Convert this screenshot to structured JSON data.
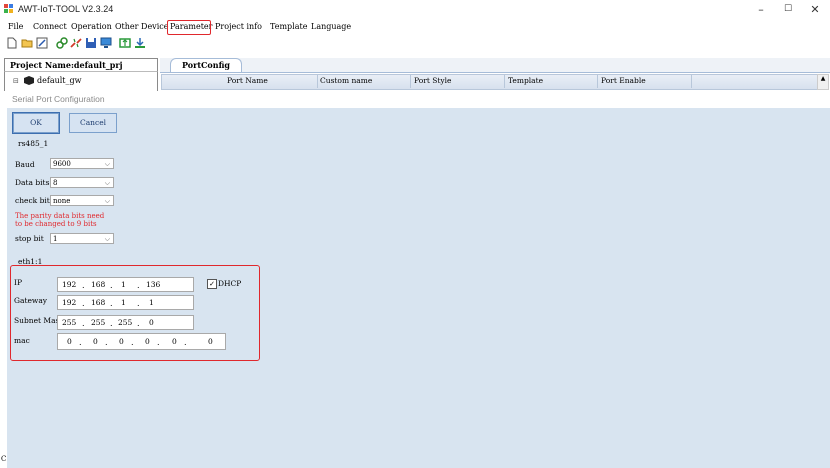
{
  "window": {
    "title": "AWT-IoT-TOOL V2.3.24",
    "controls": {
      "minimize": "–",
      "maximize": "☐",
      "close": "✕"
    }
  },
  "menu": [
    "File",
    "Connect",
    "Operation",
    "Other Device",
    "Parameter",
    "Project info",
    "Template",
    "Language"
  ],
  "project": {
    "header": "Project Name:default_prj",
    "tree_item": "default_gw"
  },
  "tabs": {
    "active": "PortConfig"
  },
  "grid": {
    "columns": [
      "Port Name",
      "Custom name",
      "Port Style",
      "Template",
      "Port Enable"
    ]
  },
  "dialog": {
    "title": "Serial Port Configuration",
    "ok_label": "OK",
    "cancel_label": "Cancel",
    "port_name": "rs485_1",
    "baud": {
      "label": "Baud",
      "value": "9600"
    },
    "data_bits": {
      "label": "Data bits",
      "value": "8"
    },
    "check_bit": {
      "label": "check bit",
      "value": "none"
    },
    "warning_line1": "The parity data bits need",
    "warning_line2": "to be changed to 9 bits",
    "stop_bit": {
      "label": "stop bit",
      "value": "1"
    },
    "eth_name": "eth1:1",
    "ip": {
      "label": "IP",
      "octets": [
        "192",
        "168",
        "1",
        "136"
      ]
    },
    "dhcp": {
      "label": "DHCP",
      "checked": true
    },
    "gateway": {
      "label": "Gateway",
      "octets": [
        "192",
        "168",
        "1",
        "1"
      ]
    },
    "subnet": {
      "label": "Subnet Mask",
      "octets": [
        "255",
        "255",
        "255",
        "0"
      ]
    },
    "mac": {
      "label": "mac",
      "octets": [
        "0",
        "0",
        "0",
        "0",
        "0",
        "0"
      ]
    }
  },
  "left_edge_letter": "C",
  "colors": {
    "highlight": "#e0282d",
    "dialog_bg": "#d8e4f0",
    "button_border": "#7ba0cc"
  }
}
